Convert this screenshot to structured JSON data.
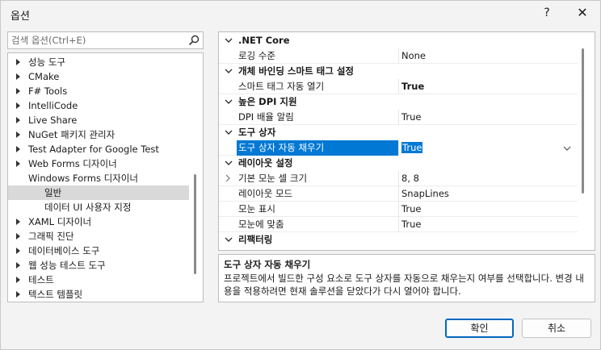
{
  "window": {
    "title": "옵션",
    "help_icon": "?",
    "close_icon": "✕"
  },
  "search": {
    "placeholder": "검색 옵션(Ctrl+E)"
  },
  "tree": {
    "items": [
      {
        "label": "성능 도구",
        "level": 0,
        "expandable": true,
        "selected": false
      },
      {
        "label": "CMake",
        "level": 0,
        "expandable": true,
        "selected": false
      },
      {
        "label": "F# Tools",
        "level": 0,
        "expandable": true,
        "selected": false
      },
      {
        "label": "IntelliCode",
        "level": 0,
        "expandable": true,
        "selected": false
      },
      {
        "label": "Live Share",
        "level": 0,
        "expandable": true,
        "selected": false
      },
      {
        "label": "NuGet 패키지 관리자",
        "level": 0,
        "expandable": true,
        "selected": false
      },
      {
        "label": "Test Adapter for Google Test",
        "level": 0,
        "expandable": true,
        "selected": false
      },
      {
        "label": "Web Forms 디자이너",
        "level": 0,
        "expandable": true,
        "selected": false
      },
      {
        "label": "Windows Forms 디자이너",
        "level": 0,
        "expandable": false,
        "selected": false
      },
      {
        "label": "일반",
        "level": 1,
        "expandable": false,
        "selected": true
      },
      {
        "label": "데이터 UI 사용자 지정",
        "level": 1,
        "expandable": false,
        "selected": false
      },
      {
        "label": "XAML 디자이너",
        "level": 0,
        "expandable": true,
        "selected": false
      },
      {
        "label": "그래픽 진단",
        "level": 0,
        "expandable": true,
        "selected": false
      },
      {
        "label": "데이터베이스 도구",
        "level": 0,
        "expandable": true,
        "selected": false
      },
      {
        "label": "웹 성능 테스트 도구",
        "level": 0,
        "expandable": true,
        "selected": false
      },
      {
        "label": "테스트",
        "level": 0,
        "expandable": true,
        "selected": false
      },
      {
        "label": "텍스트 템플릿",
        "level": 0,
        "expandable": true,
        "selected": false
      }
    ]
  },
  "grid": {
    "rows": [
      {
        "kind": "category",
        "label": ".NET Core"
      },
      {
        "kind": "prop",
        "name": "로깅 수준",
        "value": "None",
        "bold": false
      },
      {
        "kind": "category",
        "label": "개체 바인딩 스마트 태그 설정"
      },
      {
        "kind": "prop",
        "name": "스마트 태그 자동 열기",
        "value": "True",
        "bold": true
      },
      {
        "kind": "category",
        "label": "높은 DPI 지원"
      },
      {
        "kind": "prop",
        "name": "DPI 배율 알림",
        "value": "True",
        "bold": false
      },
      {
        "kind": "category",
        "label": "도구 상자"
      },
      {
        "kind": "prop",
        "name": "도구 상자 자동 채우기",
        "value": "True",
        "bold": false,
        "selected": true,
        "dropdown": true
      },
      {
        "kind": "category",
        "label": "레이아웃 설정"
      },
      {
        "kind": "prop",
        "name": "기본 모눈 셀 크기",
        "value": "8, 8",
        "bold": false,
        "expandable": true
      },
      {
        "kind": "prop",
        "name": "레이아웃 모드",
        "value": "SnapLines",
        "bold": false
      },
      {
        "kind": "prop",
        "name": "모눈 표시",
        "value": "True",
        "bold": false
      },
      {
        "kind": "prop",
        "name": "모눈에 맞춤",
        "value": "True",
        "bold": false
      },
      {
        "kind": "category",
        "label": "리팩터링"
      }
    ]
  },
  "description": {
    "title": "도구 상자 자동 채우기",
    "text": "프로젝트에서 빌드한 구성 요소로 도구 상자를 자동으로 채우는지 여부를 선택합니다. 변경 내용을 적용하려면 현재 솔루션을 닫았다가 다시 열어야 합니다."
  },
  "buttons": {
    "ok": "확인",
    "cancel": "취소"
  },
  "colors": {
    "accent": "#0078d4",
    "selected_tree": "#d9d9d9"
  }
}
